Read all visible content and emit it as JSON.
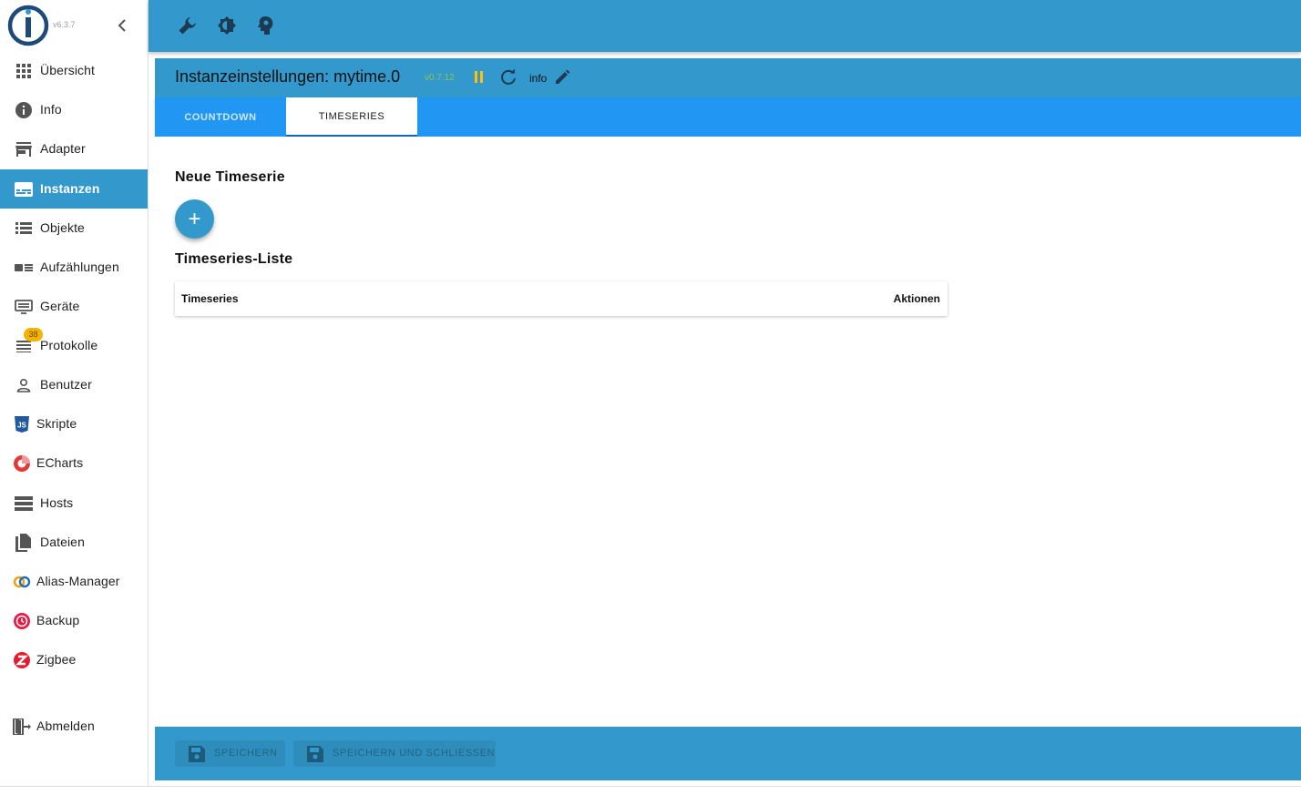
{
  "app": {
    "version": "v6.3.7"
  },
  "sidebar": {
    "items": [
      {
        "label": "Übersicht",
        "icon": "apps-grid-icon"
      },
      {
        "label": "Info",
        "icon": "info-icon"
      },
      {
        "label": "Adapter",
        "icon": "store-icon"
      },
      {
        "label": "Instanzen",
        "icon": "instances-icon",
        "active": true
      },
      {
        "label": "Objekte",
        "icon": "list-icon"
      },
      {
        "label": "Aufzählungen",
        "icon": "enums-icon"
      },
      {
        "label": "Geräte",
        "icon": "devices-icon"
      },
      {
        "label": "Protokolle",
        "icon": "logs-icon",
        "badge": "38"
      },
      {
        "label": "Benutzer",
        "icon": "user-icon"
      },
      {
        "label": "Skripte",
        "icon": "javascript-icon"
      },
      {
        "label": "ECharts",
        "icon": "echarts-icon"
      },
      {
        "label": "Hosts",
        "icon": "hosts-icon"
      },
      {
        "label": "Dateien",
        "icon": "files-icon"
      },
      {
        "label": "Alias-Manager",
        "icon": "alias-icon"
      },
      {
        "label": "Backup",
        "icon": "backup-icon"
      },
      {
        "label": "Zigbee",
        "icon": "zigbee-icon"
      }
    ],
    "logout_label": "Abmelden"
  },
  "instance": {
    "title": "Instanzeinstellungen: mytime.0",
    "version": "v0.7.12",
    "log_level": "info"
  },
  "tabs": [
    {
      "label": "COUNTDOWN",
      "active": false
    },
    {
      "label": "TIMESERIES",
      "active": true
    }
  ],
  "main": {
    "new_heading": "Neue Timeserie",
    "add_label": "+",
    "list_heading": "Timeseries-Liste",
    "table": {
      "columns": [
        "Timeseries",
        "Aktionen"
      ]
    }
  },
  "footer": {
    "save_label": "SPEICHERN",
    "save_close_label": "SPEICHERN UND SCHLIESSEN"
  },
  "colors": {
    "primary": "#3399cc",
    "tab_bar": "#2196f3",
    "badge": "#f2b400",
    "version": "#8bc34a",
    "pause": "#ffc107"
  }
}
